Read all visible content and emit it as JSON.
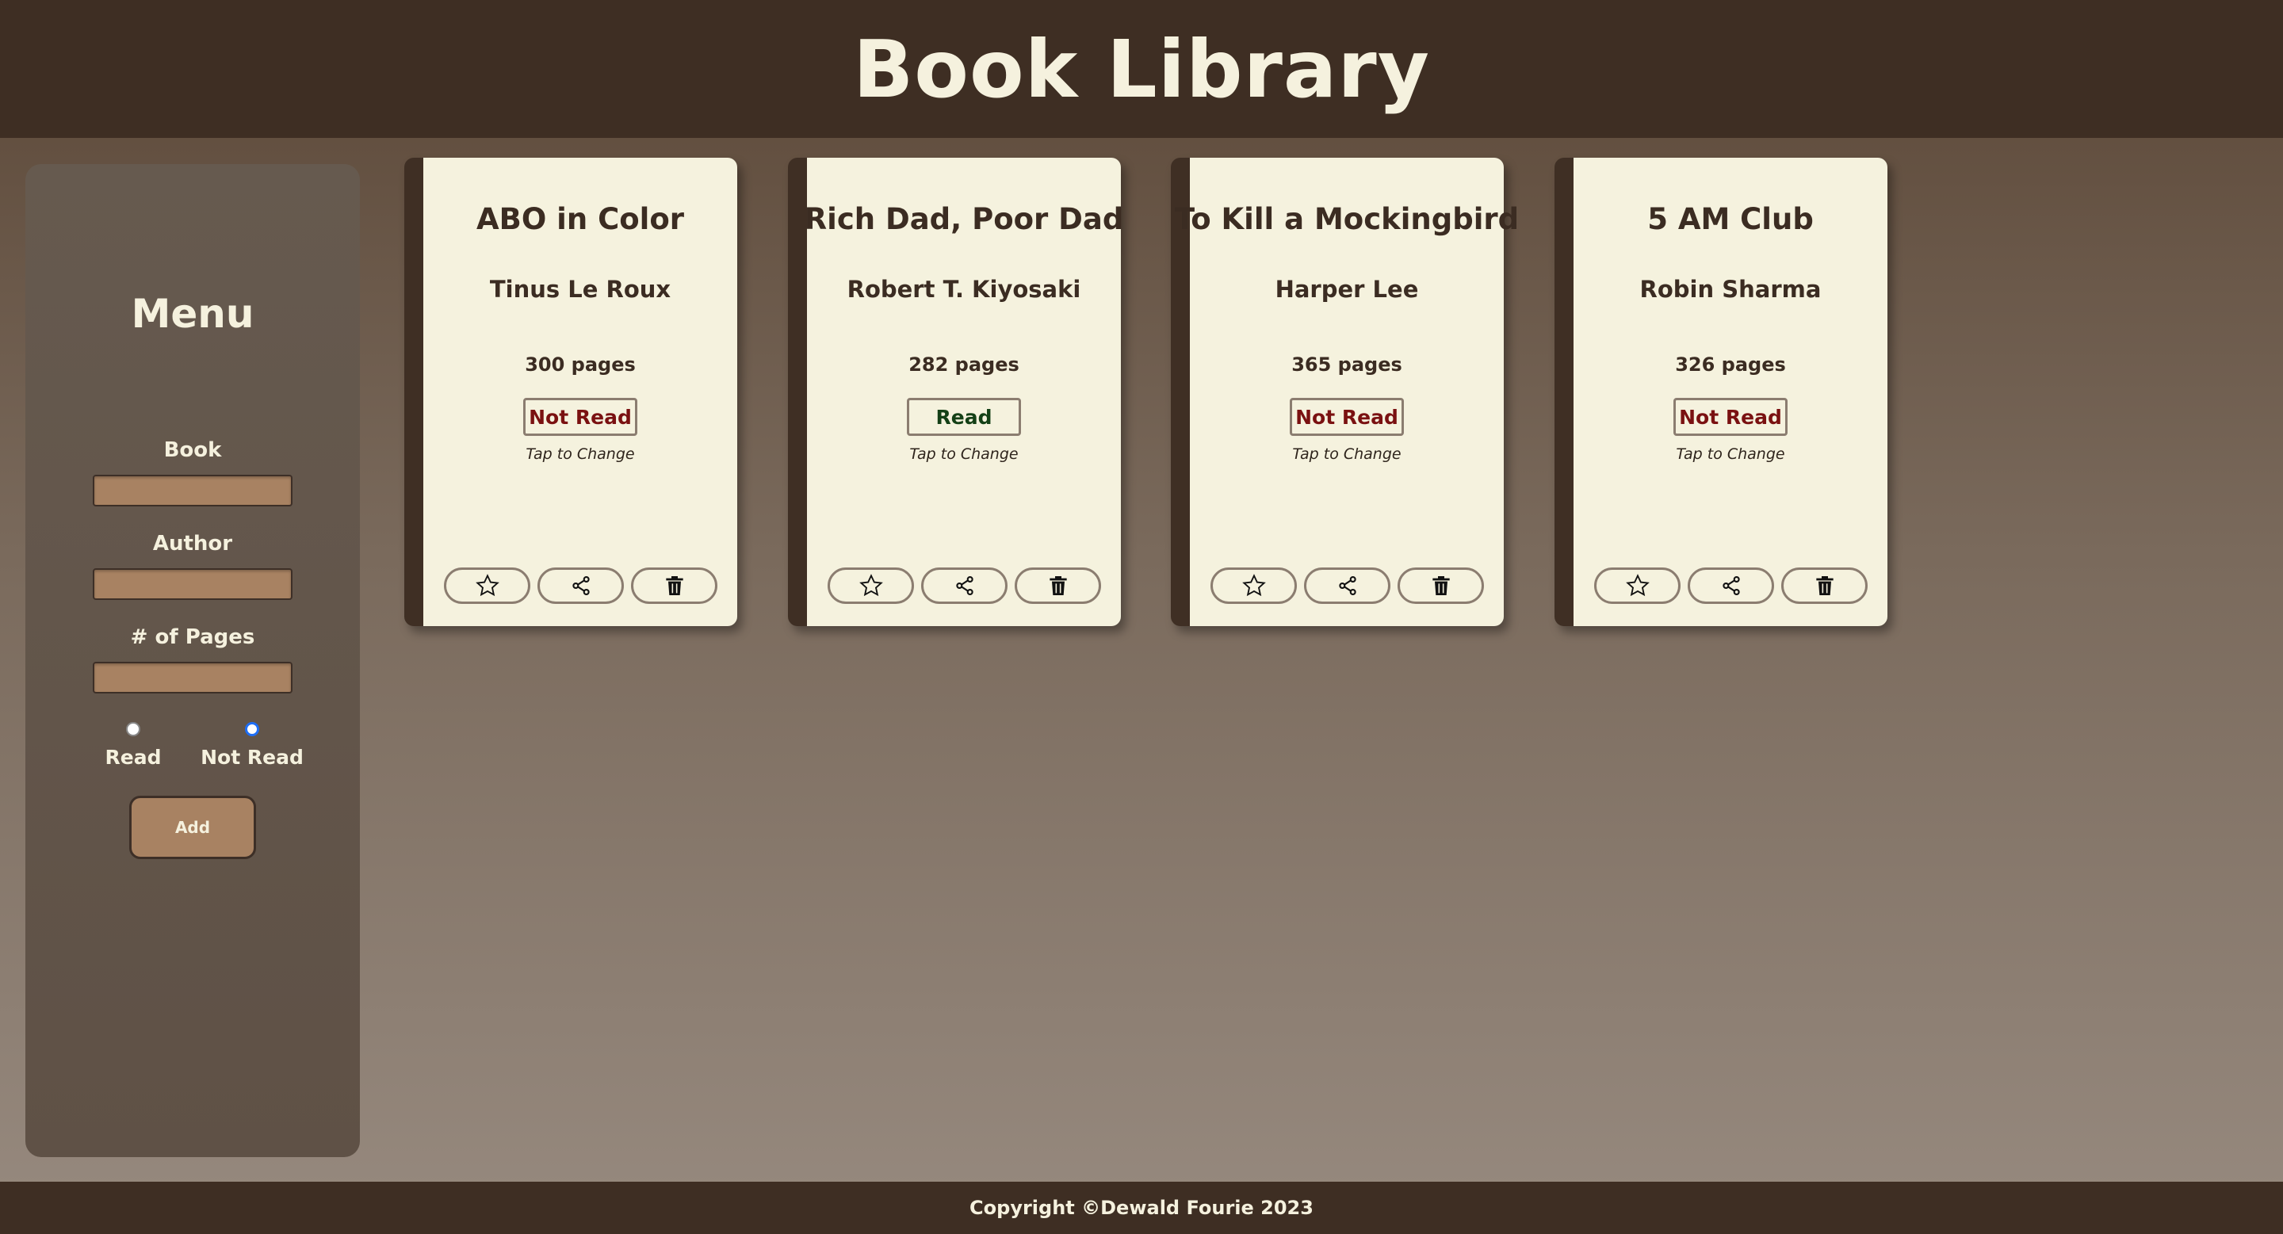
{
  "header": {
    "title": "Book Library"
  },
  "menu": {
    "title": "Menu",
    "book_label": "Book",
    "author_label": "Author",
    "pages_label": "# of Pages",
    "book_value": "",
    "author_value": "",
    "pages_value": "",
    "radio_read_label": "Read",
    "radio_not_read_label": "Not Read",
    "selected_status": "Not Read",
    "add_label": "Add"
  },
  "cards": [
    {
      "title": "ABO in Color",
      "author": "Tinus Le Roux",
      "pages": "300 pages",
      "status": "Not Read",
      "tap": "Tap to Change"
    },
    {
      "title": "Rich Dad, Poor Dad",
      "author": "Robert T. Kiyosaki",
      "pages": "282 pages",
      "status": "Read",
      "tap": "Tap to Change"
    },
    {
      "title": "To Kill a Mockingbird",
      "author": "Harper Lee",
      "pages": "365 pages",
      "status": "Not Read",
      "tap": "Tap to Change"
    },
    {
      "title": "5 AM Club",
      "author": "Robin Sharma",
      "pages": "326 pages",
      "status": "Not Read",
      "tap": "Tap to Change"
    }
  ],
  "card_icons": [
    "star-icon",
    "share-icon",
    "trash-icon"
  ],
  "colors": {
    "header_bg": "#3e2e23",
    "card_bg": "#f5f2de",
    "not_read": "#7a1111",
    "read": "#144016",
    "input_bg": "#a88262"
  },
  "footer": {
    "copyright": "Copyright ©Dewald Fourie 2023"
  }
}
